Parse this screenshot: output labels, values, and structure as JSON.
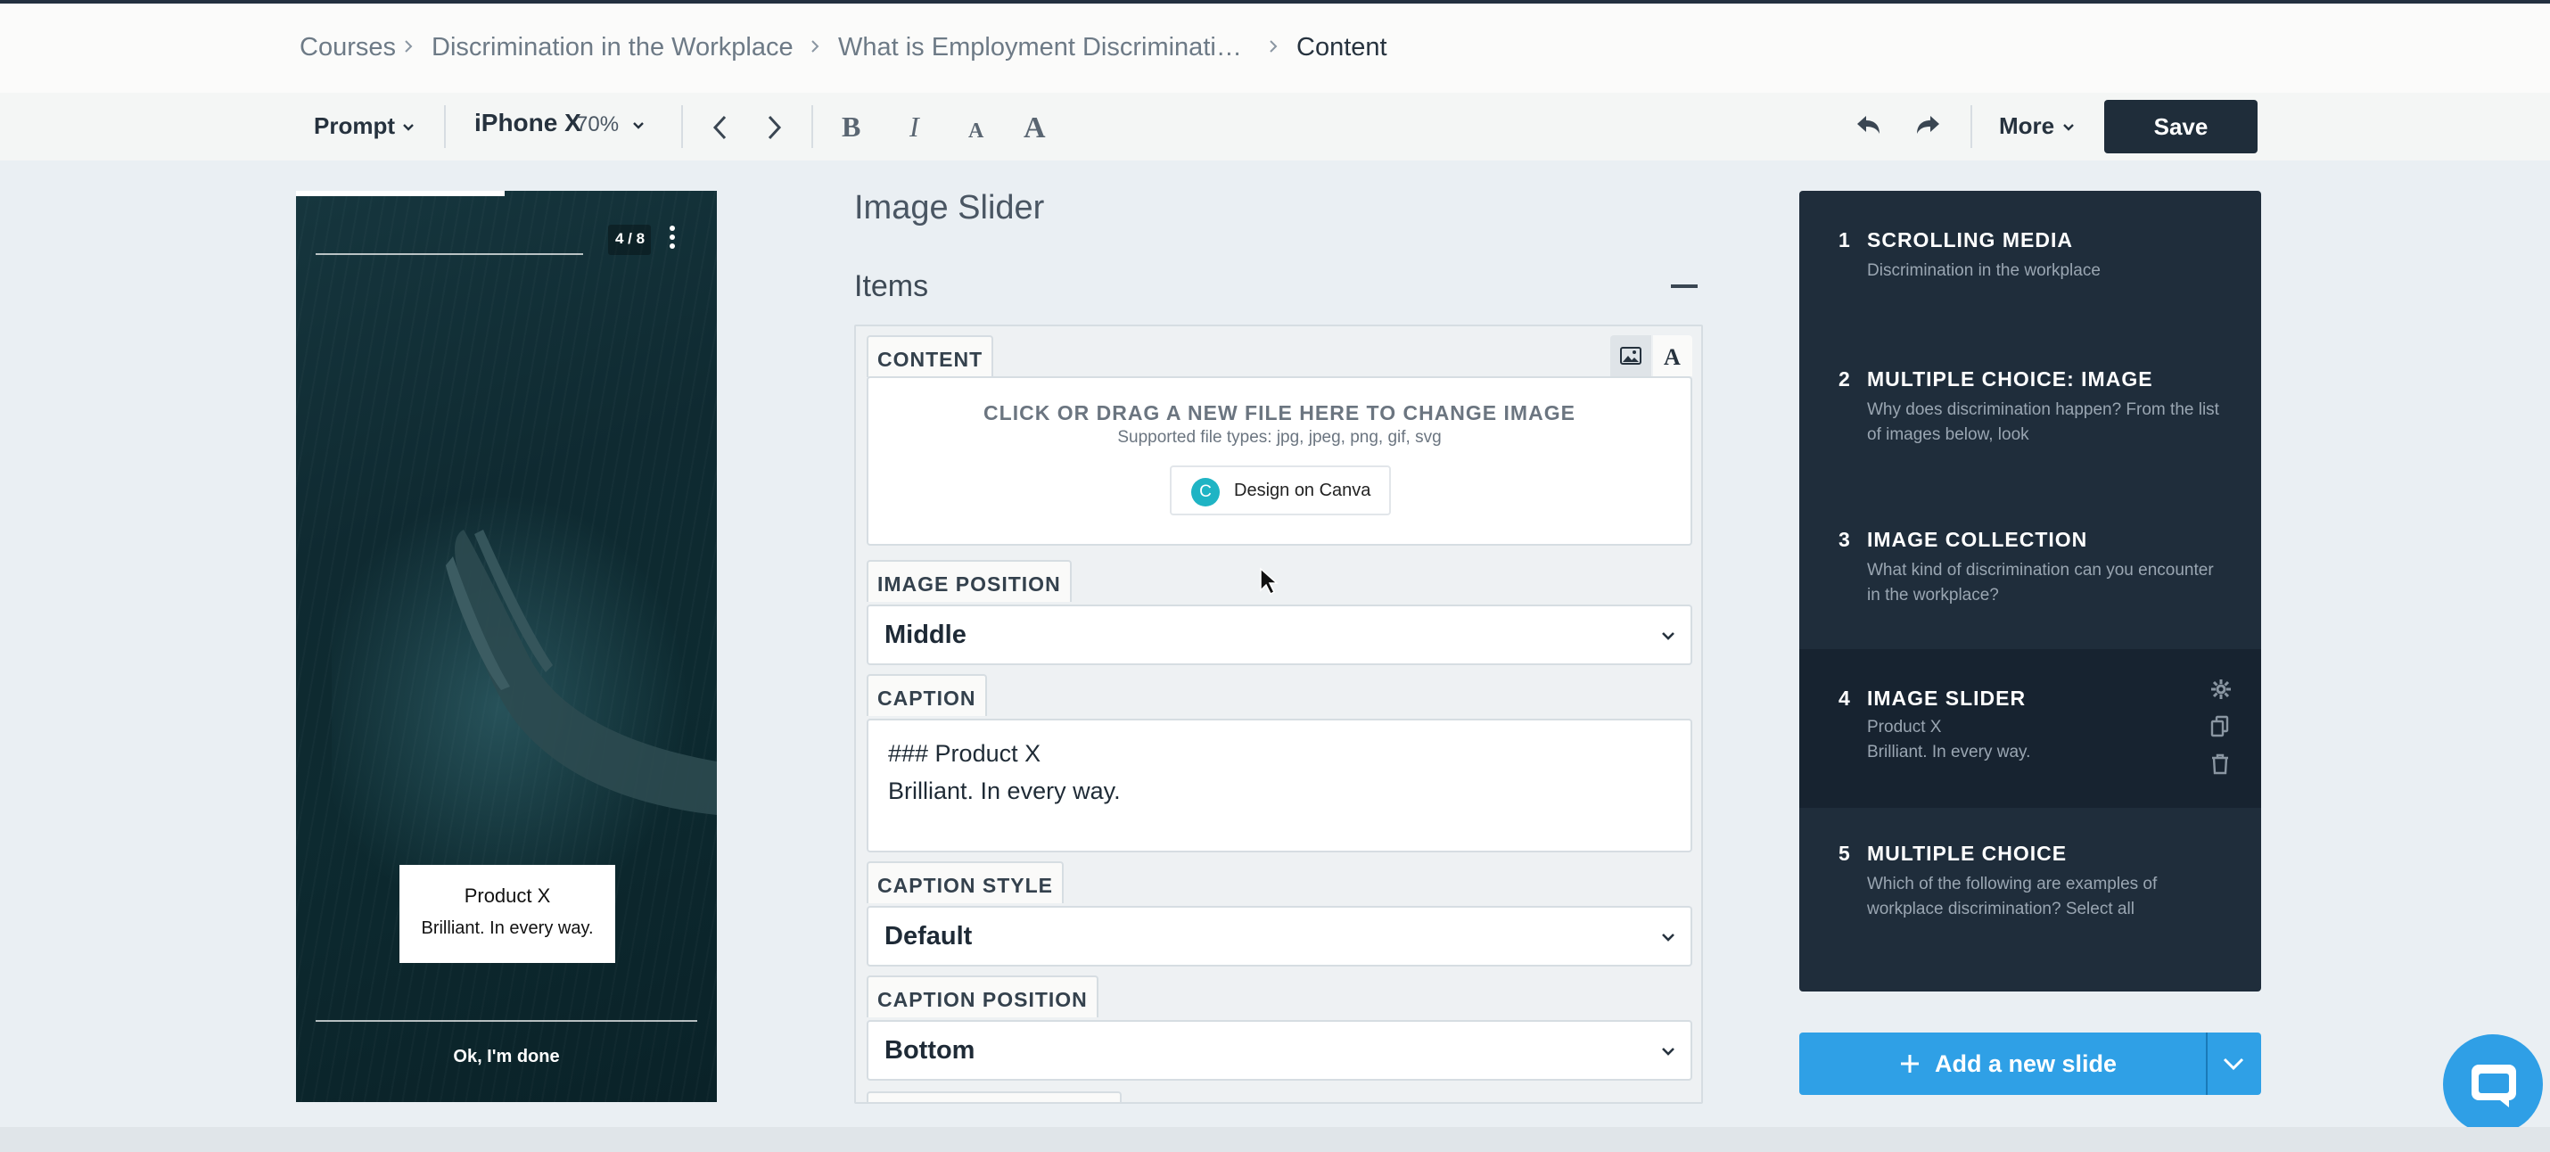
{
  "breadcrumb": [
    "Courses",
    "Discrimination in the Workplace",
    "What is Employment Discriminati…",
    "Content"
  ],
  "toolbar": {
    "mode_label": "Prompt",
    "device_name": "iPhone X",
    "device_zoom": "70%",
    "more_label": "More",
    "save_label": "Save"
  },
  "preview": {
    "progress": "4 / 8",
    "caption_title": "Product X",
    "caption_body": "Brilliant. In every way.",
    "done_label": "Ok, I'm done"
  },
  "editor": {
    "slide_title": "Image Slider",
    "items_title": "Items",
    "content_label": "CONTENT",
    "dropzone_title": "CLICK OR DRAG A NEW FILE HERE TO CHANGE IMAGE",
    "dropzone_sub": "Supported file types: jpg, jpeg, png, gif, svg",
    "canva_label": "Design on Canva",
    "canva_letter": "C",
    "image_position_label": "IMAGE POSITION",
    "image_position_value": "Middle",
    "caption_label": "CAPTION",
    "caption_value": "### Product X\nBrilliant. In every way.",
    "caption_style_label": "CAPTION STYLE",
    "caption_style_value": "Default",
    "caption_position_label": "CAPTION POSITION",
    "caption_position_value": "Bottom"
  },
  "slides": [
    {
      "num": "1",
      "title": "SCROLLING MEDIA",
      "desc": "Discrimination in the workplace"
    },
    {
      "num": "2",
      "title": "MULTIPLE CHOICE: IMAGE",
      "desc": "Why does discrimination happen? From the list of images below, look"
    },
    {
      "num": "3",
      "title": "IMAGE COLLECTION",
      "desc": "What kind of discrimination can you encounter in the workplace?"
    },
    {
      "num": "4",
      "title": "IMAGE SLIDER",
      "desc": "Product X\nBrilliant. In every way."
    },
    {
      "num": "5",
      "title": "MULTIPLE CHOICE",
      "desc": "Which of the following are examples of workplace discrimination? Select all"
    }
  ],
  "add_slide_label": "Add a new slide",
  "colors": {
    "accent": "#2fa0e6",
    "dark": "#1f2d3a",
    "panel": "#1f2d3b"
  }
}
